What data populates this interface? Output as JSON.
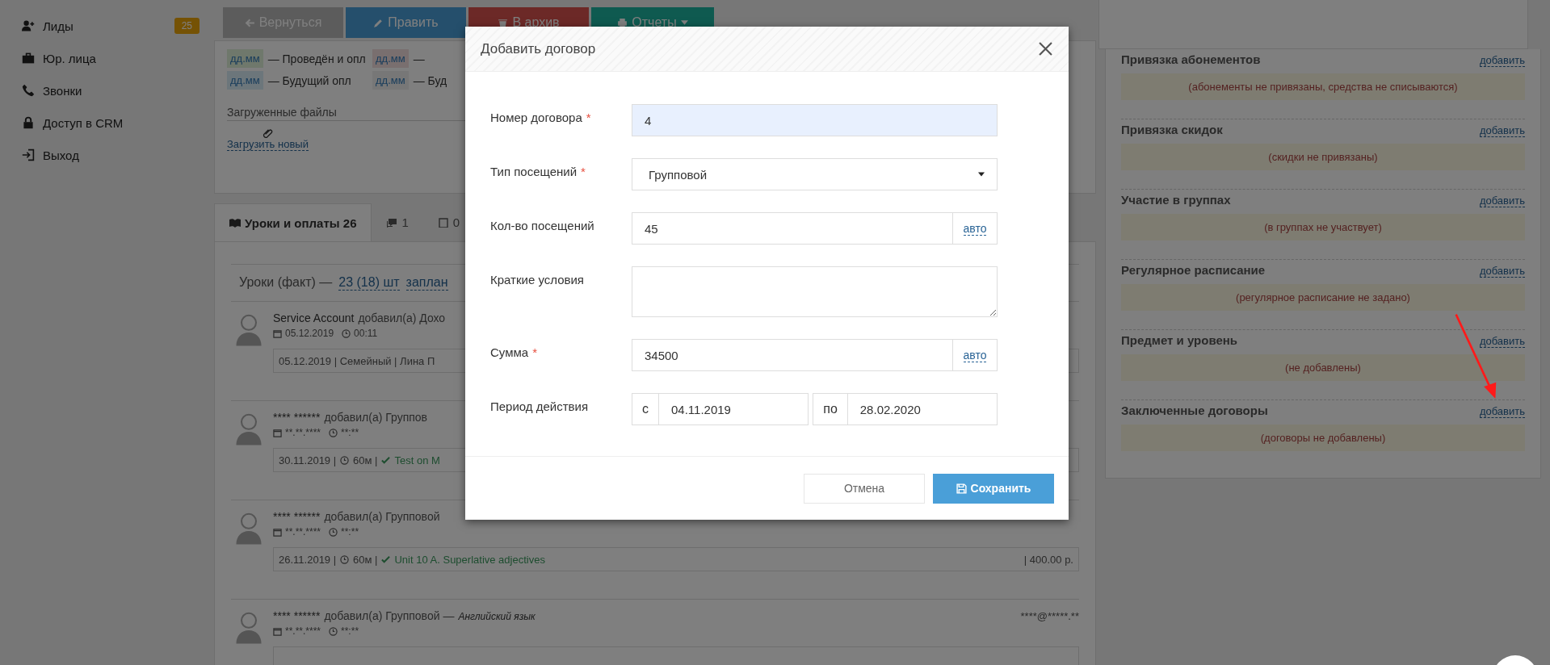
{
  "sidebar": {
    "items": [
      {
        "label": "Лиды",
        "kind": "leads",
        "badge": "25"
      },
      {
        "label": "Юр. лица",
        "kind": "companies"
      },
      {
        "label": "Звонки",
        "kind": "calls"
      },
      {
        "label": "Доступ в CRM",
        "kind": "access"
      },
      {
        "label": "Выход",
        "kind": "logout"
      }
    ]
  },
  "toolbar": {
    "buttons": [
      {
        "label": "Вернуться",
        "kind": "back"
      },
      {
        "label": "Править",
        "kind": "edit"
      },
      {
        "label": "В архив",
        "kind": "archive"
      },
      {
        "label": "Отчеты",
        "kind": "reports"
      }
    ]
  },
  "legend": [
    {
      "sample": "дд.мм",
      "text": "— Проведён и опл",
      "kind": "done"
    },
    {
      "sample": "дд.мм",
      "text": "—",
      "kind": "missed"
    },
    {
      "sample": "дд.мм",
      "text": "— Будущий опл",
      "kind": "future"
    },
    {
      "sample": "дд.мм",
      "text": "— Буд",
      "kind": "planned"
    }
  ],
  "files": {
    "title": "Загруженные файлы",
    "upload": "Загрузить новый"
  },
  "tabs": [
    {
      "label": "Уроки и оплаты 26",
      "kind": "lessons",
      "selected": true
    },
    {
      "label": "1",
      "kind": "comments",
      "selected": false
    },
    {
      "label": "0",
      "kind": "tasks",
      "selected": false
    }
  ],
  "summary": {
    "text": "Уроки (факт) —",
    "count": "23 (18) шт",
    "planned": "заплан"
  },
  "entries": [
    {
      "author": "Service Account",
      "action": "добавил(а) Дохо",
      "date": "05.12.2019",
      "time": "00:11",
      "details": [
        {
          "kind": "text",
          "text": "05.12.2019 | Семейный | Лина П"
        }
      ]
    },
    {
      "author": "**** ******",
      "action": "добавил(а) Группов",
      "date": "**.**.****",
      "time": "**:**",
      "details": [
        {
          "kind": "text",
          "text": "30.11.2019 |"
        },
        {
          "kind": "duration",
          "text": "60м |"
        },
        {
          "kind": "topic",
          "text": "Test on M"
        }
      ]
    },
    {
      "author": "**** ******",
      "action": "добавил(а) Групповой",
      "date": "**.**.****",
      "time": "**:**",
      "details": [
        {
          "kind": "text",
          "text": "26.11.2019 |"
        },
        {
          "kind": "duration",
          "text": "60м |"
        },
        {
          "kind": "topic",
          "text": "Unit 10 A. Superlative adjectives"
        }
      ],
      "amount": "| 400.00 р."
    },
    {
      "author": "**** ******",
      "action": "добавил(а) Групповой —",
      "subject": "Английский язык",
      "email": "****@*****.**",
      "date": "**.**.****",
      "time": "**:**"
    }
  ],
  "sections": [
    {
      "title": "Привязка абонементов",
      "action": "добавить",
      "empty": "(абонементы не привязаны, средства не списываются)"
    },
    {
      "title": "Привязка скидок",
      "action": "добавить",
      "empty": "(скидки не привязаны)"
    },
    {
      "title": "Участие в группах",
      "action": "добавить",
      "empty": "(в группах не участвует)"
    },
    {
      "title": "Регулярное расписание",
      "action": "добавить",
      "empty": "(регулярное расписание не задано)"
    },
    {
      "title": "Предмет и уровень",
      "action": "добавить",
      "empty": "(не добавлены)"
    },
    {
      "title": "Заключенные договоры",
      "action": "добавить",
      "empty": "(договоры не добавлены)"
    }
  ],
  "modal": {
    "title": "Добавить договор",
    "fields": [
      {
        "kind": "text",
        "label": "Номер договора",
        "mark": "*",
        "value": "4",
        "autofilled": true
      },
      {
        "kind": "select",
        "label": "Тип посещений",
        "mark": "*",
        "value": "Групповой",
        "autofilled": false
      },
      {
        "kind": "auto",
        "label": "Кол-во посещений",
        "value": "45",
        "button": "авто",
        "autofilled": false
      },
      {
        "kind": "textarea",
        "label": "Краткие условия",
        "autofilled": false
      },
      {
        "kind": "auto",
        "label": "Сумма",
        "mark": "*",
        "value": "34500",
        "button": "авто",
        "autofilled": false
      },
      {
        "kind": "period",
        "label": "Период действия",
        "from_label": "с",
        "from": "04.11.2019",
        "to_label": "по",
        "to": "28.02.2020",
        "autofilled": false
      }
    ],
    "cancel": "Отмена",
    "save": "Сохранить"
  }
}
